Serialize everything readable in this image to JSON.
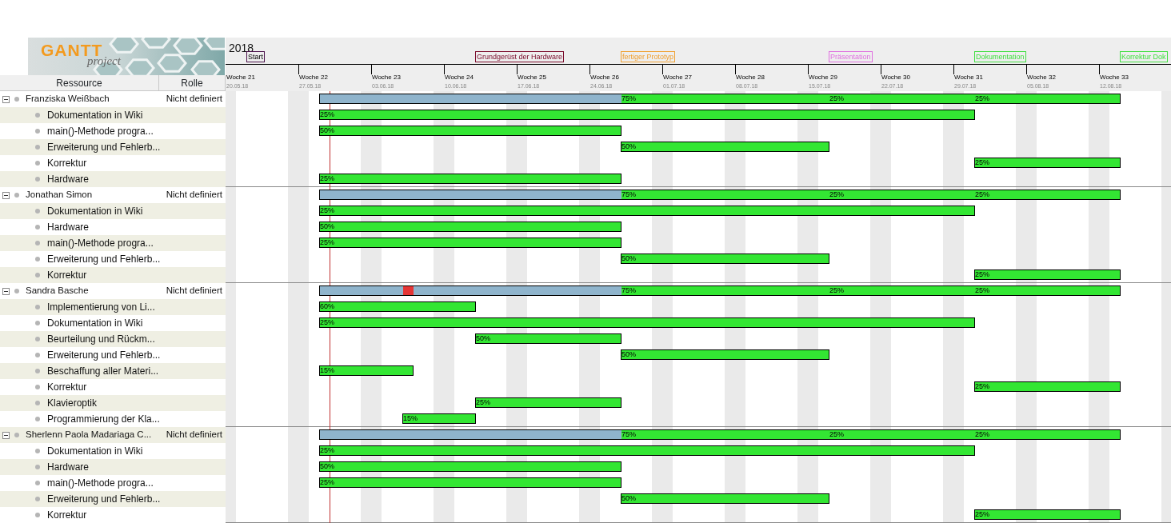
{
  "logo": {
    "title": "GANTT",
    "subtitle": "project"
  },
  "columns": [
    "Ressource",
    "Rolle"
  ],
  "timeline": {
    "year": "2018",
    "weeks": [
      {
        "label": "Woche 21",
        "date": "20.05.18"
      },
      {
        "label": "Woche 22",
        "date": "27.05.18"
      },
      {
        "label": "Woche 23",
        "date": "03.06.18"
      },
      {
        "label": "Woche 24",
        "date": "10.06.18"
      },
      {
        "label": "Woche 25",
        "date": "17.06.18"
      },
      {
        "label": "Woche 26",
        "date": "24.06.18"
      },
      {
        "label": "Woche 27",
        "date": "01.07.18"
      },
      {
        "label": "Woche 28",
        "date": "08.07.18"
      },
      {
        "label": "Woche 29",
        "date": "15.07.18"
      },
      {
        "label": "Woche 30",
        "date": "22.07.18"
      },
      {
        "label": "Woche 31",
        "date": "29.07.18"
      },
      {
        "label": "Woche 32",
        "date": "05.08.18"
      },
      {
        "label": "Woche 33",
        "date": "12.08.18"
      }
    ],
    "milestones": [
      {
        "label": "Start",
        "color": "#4b124b"
      },
      {
        "label": "Grundgerüst der Hardware",
        "color": "#7a0a2a"
      },
      {
        "label": "fertiger Prototyp",
        "color": "#f0a030"
      },
      {
        "label": "Präsentation",
        "color": "#e070e0"
      },
      {
        "label": "Dokumentation",
        "color": "#40e040"
      },
      {
        "label": "Korrektur Dok",
        "color": "#40e040"
      }
    ]
  },
  "resources": [
    {
      "name": "Franziska Weißbach",
      "role": "Nicht definiert",
      "expanded": true,
      "load": [
        {
          "kind": "full"
        },
        {
          "kind": "under",
          "label": "75%"
        },
        {
          "kind": "under",
          "label": "25%"
        },
        {
          "kind": "under",
          "label": "25%"
        }
      ],
      "tasks": [
        {
          "name": "Dokumentation in Wiki",
          "label": "25%"
        },
        {
          "name": "main()-Methode progra...",
          "label": "50%"
        },
        {
          "name": "Erweiterung und Fehlerb...",
          "label": "50%"
        },
        {
          "name": "Korrektur",
          "label": "25%"
        },
        {
          "name": "Hardware",
          "label": "25%"
        }
      ]
    },
    {
      "name": "Jonathan Simon",
      "role": "Nicht definiert",
      "expanded": true,
      "load": [
        {
          "kind": "full"
        },
        {
          "kind": "under",
          "label": "75%"
        },
        {
          "kind": "under",
          "label": "25%"
        },
        {
          "kind": "under",
          "label": "25%"
        }
      ],
      "tasks": [
        {
          "name": "Dokumentation in Wiki",
          "label": "25%"
        },
        {
          "name": "Hardware",
          "label": "50%"
        },
        {
          "name": "main()-Methode progra...",
          "label": "25%"
        },
        {
          "name": "Erweiterung und Fehlerb...",
          "label": "50%"
        },
        {
          "name": "Korrektur",
          "label": "25%"
        }
      ]
    },
    {
      "name": "Sandra Basche",
      "role": "Nicht definiert",
      "expanded": true,
      "load": [
        {
          "kind": "full"
        },
        {
          "kind": "over"
        },
        {
          "kind": "full"
        },
        {
          "kind": "under",
          "label": "75%"
        },
        {
          "kind": "under",
          "label": "25%"
        },
        {
          "kind": "under",
          "label": "25%"
        }
      ],
      "tasks": [
        {
          "name": "Implementierung von Li...",
          "label": "60%"
        },
        {
          "name": "Dokumentation in Wiki",
          "label": "25%"
        },
        {
          "name": "Beurteilung und Rückm...",
          "label": "50%"
        },
        {
          "name": "Erweiterung und Fehlerb...",
          "label": "50%"
        },
        {
          "name": "Beschaffung aller Materi...",
          "label": "15%"
        },
        {
          "name": "Korrektur",
          "label": "25%"
        },
        {
          "name": "Klavieroptik",
          "label": "25%"
        },
        {
          "name": "Programmierung der Kla...",
          "label": "15%"
        }
      ]
    },
    {
      "name": "Sherlenn Paola Madariaga C...",
      "role": "Nicht definiert",
      "expanded": true,
      "load": [
        {
          "kind": "full"
        },
        {
          "kind": "under",
          "label": "75%"
        },
        {
          "kind": "under",
          "label": "25%"
        },
        {
          "kind": "under",
          "label": "25%"
        }
      ],
      "tasks": [
        {
          "name": "Dokumentation in Wiki",
          "label": "25%"
        },
        {
          "name": "Hardware",
          "label": "50%"
        },
        {
          "name": "main()-Methode progra...",
          "label": "25%"
        },
        {
          "name": "Erweiterung und Fehlerb...",
          "label": "50%"
        },
        {
          "name": "Korrektur",
          "label": "25%"
        }
      ]
    }
  ]
}
